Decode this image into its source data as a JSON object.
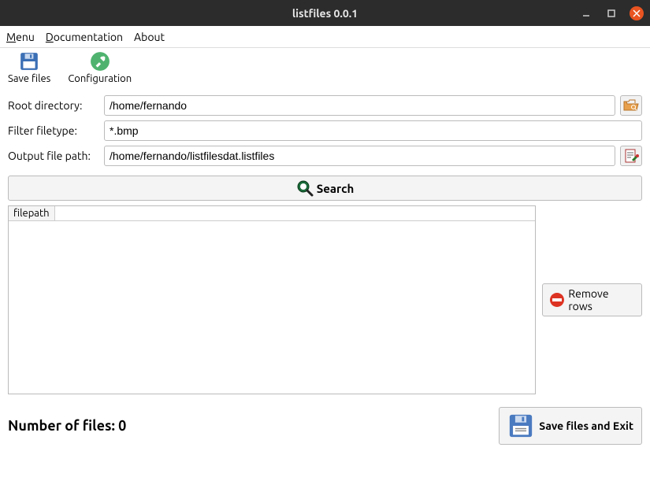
{
  "window": {
    "title": "listfiles 0.0.1"
  },
  "menubar": {
    "menu": "Menu",
    "documentation": "Documentation",
    "about": "About"
  },
  "toolbar": {
    "save_files": "Save files",
    "configuration": "Configuration"
  },
  "form": {
    "root_label": "Root directory:",
    "root_value": "/home/fernando",
    "filter_label": "Filter filetype:",
    "filter_value": "*.bmp",
    "output_label": "Output file path:",
    "output_value": "/home/fernando/listfilesdat.listfiles"
  },
  "buttons": {
    "search": "Search",
    "remove_rows": "Remove rows",
    "save_exit": "Save files and Exit"
  },
  "table": {
    "header": "filepath"
  },
  "status": {
    "count_label": "Number of files: 0"
  }
}
